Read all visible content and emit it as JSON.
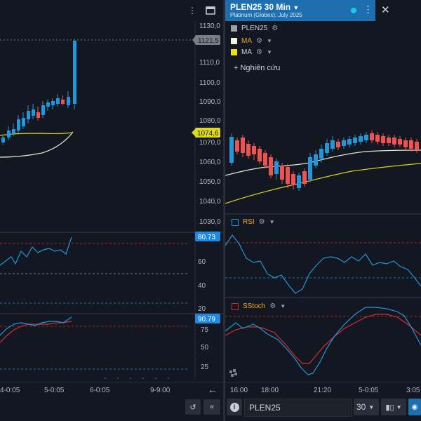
{
  "left_chart": {
    "price_axis": [
      "1130,0",
      "1110,0",
      "1100,0",
      "1090,0",
      "1080,0",
      "1070,0",
      "1060,0",
      "1050,0",
      "1040,0",
      "1030,0"
    ],
    "last_price_tag": "1121,5",
    "ma_tag": "1074,6",
    "rsi_tag": "80.73",
    "rsi_axis": [
      "60",
      "40",
      "20"
    ],
    "stoch_tag": "90.79",
    "stoch_axis": [
      "75",
      "50",
      "25"
    ],
    "time_axis": [
      "4-0:05",
      "5-0:05",
      "6-0:05",
      "9-9:00"
    ],
    "scroll_right_icon": "arrow-left-icon",
    "rewind_icon": "reset-icon",
    "double_left_icon": "double-chevron-left-icon"
  },
  "right_chart": {
    "header": {
      "title": "PLEN25 30 Min",
      "subtitle": "Platinum (Globex): July 2025",
      "status_color": "#1cc8e8"
    },
    "legend": [
      {
        "label": "PLEN25",
        "color": "#9aa0a6",
        "text_color": "#d1d4dc"
      },
      {
        "label": "MA",
        "color": "#f5f5dc",
        "text_color": "#f5a623"
      },
      {
        "label": "MA",
        "color": "#f0e010",
        "text_color": "#d1d4dc"
      }
    ],
    "study_button": "+ Nghiên cứu",
    "rsi_label": "RSI",
    "stoch_label": "SStoch",
    "time_axis": [
      "16:00",
      "18:00",
      "21:20",
      "5-0:05",
      "3:05"
    ],
    "bottom": {
      "symbol": "PLEN25",
      "interval": "30",
      "info_icon": "info-icon"
    }
  },
  "colors": {
    "up": "#2196d8",
    "down": "#ef5350",
    "ma_light": "#e8e4d0",
    "ma_yellow": "#d8d020",
    "rsi_line": "#2196d8",
    "stoch_k": "#2196d8",
    "stoch_d": "#d32f2f"
  }
}
